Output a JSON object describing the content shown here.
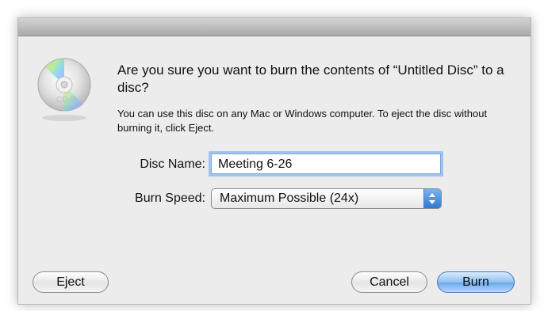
{
  "dialog": {
    "icon": {
      "name": "cd-r-disc-icon",
      "label": "CD-R"
    },
    "question": "Are you sure you want to burn the contents of “Untitled Disc” to a disc?",
    "info": "You can use this disc on any Mac or Windows computer. To eject the disc without burning it, click Eject.",
    "fields": {
      "disc_name_label": "Disc Name:",
      "disc_name_value": "Meeting 6-26",
      "burn_speed_label": "Burn Speed:",
      "burn_speed_value": "Maximum Possible (24x)"
    },
    "buttons": {
      "eject": "Eject",
      "cancel": "Cancel",
      "burn": "Burn"
    },
    "colors": {
      "focus_ring": "#9fc4f2",
      "default_button": "#6aa7e8",
      "popup_arrow": "#2f78d1"
    }
  }
}
